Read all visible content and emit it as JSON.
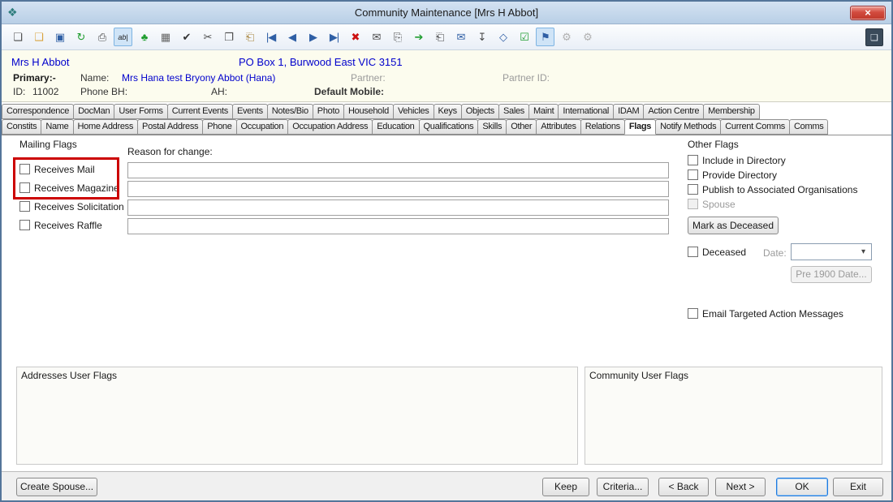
{
  "window": {
    "title": "Community Maintenance  [Mrs H Abbot]",
    "app_icon_glyph": "❖",
    "close_glyph": "×"
  },
  "toolbar": {
    "icons": [
      {
        "name": "new-document-icon",
        "glyph": "❏",
        "color": "#4a4a4a"
      },
      {
        "name": "open-folder-icon",
        "glyph": "❑",
        "color": "#d9a33c"
      },
      {
        "name": "save-icon",
        "glyph": "▣",
        "color": "#2f5fa5"
      },
      {
        "name": "refresh-icon",
        "glyph": "↻",
        "color": "#1f9d2f"
      },
      {
        "name": "print-icon",
        "glyph": "⎙",
        "color": "#4a4a4a"
      },
      {
        "name": "textbox-edit-icon",
        "glyph": "ab|",
        "color": "#1a1a1a",
        "pressed": true,
        "text": true
      },
      {
        "name": "tree-icon",
        "glyph": "♣",
        "color": "#1f9d2f"
      },
      {
        "name": "table-icon",
        "glyph": "▦",
        "color": "#666666"
      },
      {
        "name": "spellcheck-icon",
        "glyph": "✔",
        "color": "#333333"
      },
      {
        "name": "cut-icon",
        "glyph": "✂",
        "color": "#4a4a4a"
      },
      {
        "name": "copy-icon",
        "glyph": "❐",
        "color": "#4a4a4a"
      },
      {
        "name": "paste-icon",
        "glyph": "⎗",
        "color": "#a8843c"
      },
      {
        "name": "first-record-icon",
        "glyph": "|◀",
        "color": "#2f5fa5"
      },
      {
        "name": "previous-record-icon",
        "glyph": "◀",
        "color": "#2f5fa5"
      },
      {
        "name": "next-record-icon",
        "glyph": "▶",
        "color": "#2f5fa5"
      },
      {
        "name": "last-record-icon",
        "glyph": "▶|",
        "color": "#2f5fa5"
      },
      {
        "name": "delete-icon",
        "glyph": "✖",
        "color": "#cc1111"
      },
      {
        "name": "email-icon",
        "glyph": "✉",
        "color": "#4a4a4a"
      },
      {
        "name": "send-to-icon",
        "glyph": "⎘",
        "color": "#4a4a4a"
      },
      {
        "name": "forward-icon",
        "glyph": "➔",
        "color": "#1f9d2f"
      },
      {
        "name": "clipboard-import-icon",
        "glyph": "⎗",
        "color": "#4a4a4a"
      },
      {
        "name": "clipboard-mail-icon",
        "glyph": "✉",
        "color": "#2f5fa5"
      },
      {
        "name": "clipboard-export-icon",
        "glyph": "↧",
        "color": "#4a4a4a"
      },
      {
        "name": "tag-icon",
        "glyph": "◇",
        "color": "#2f5fa5"
      },
      {
        "name": "checklist-icon",
        "glyph": "☑",
        "color": "#1f9d2f"
      },
      {
        "name": "pushpin-icon",
        "glyph": "⚑",
        "color": "#2f5fa5",
        "pressed": true
      },
      {
        "name": "settings-gears-icon",
        "glyph": "⚙",
        "color": "#b0b0b0"
      },
      {
        "name": "sync-gears-icon",
        "glyph": "⚙",
        "color": "#b0b0b0"
      }
    ],
    "right_icon": {
      "name": "panel-toggle-icon",
      "glyph": "❏"
    }
  },
  "header": {
    "display_name": "Mrs H Abbot",
    "address": "PO Box 1, Burwood East VIC 3151",
    "primary_label": "Primary:-",
    "name_label": "Name:",
    "name_value": "Mrs Hana test Bryony Abbot (Hana)",
    "partner_label": "Partner:",
    "partner_id_label": "Partner ID:",
    "id_label": "ID:",
    "id_value": "11002",
    "phone_bh_label": "Phone BH:",
    "ah_label": "AH:",
    "default_mobile_label": "Default Mobile:"
  },
  "tabs": {
    "row1": [
      "Correspondence",
      "DocMan",
      "User Forms",
      "Current Events",
      "Events",
      "Notes/Bio",
      "Photo",
      "Household",
      "Vehicles",
      "Keys",
      "Objects",
      "Sales",
      "Maint",
      "International",
      "IDAM",
      "Action Centre",
      "Membership"
    ],
    "row2": [
      "Constits",
      "Name",
      "Home Address",
      "Postal Address",
      "Phone",
      "Occupation",
      "Occupation Address",
      "Education",
      "Qualifications",
      "Skills",
      "Other",
      "Attributes",
      "Relations",
      "Flags",
      "Notify Methods",
      "Current Comms",
      "Comms"
    ],
    "selected": "Flags"
  },
  "mailing_flags": {
    "group_label": "Mailing Flags",
    "reason_label": "Reason for change:",
    "checkboxes": [
      {
        "label": "Receives Mail",
        "checked": false,
        "highlighted": true
      },
      {
        "label": "Receives Magazine",
        "checked": false,
        "highlighted": true
      },
      {
        "label": "Receives Solicitation",
        "checked": false
      },
      {
        "label": "Receives Raffle",
        "checked": false
      }
    ],
    "reason_fields": [
      "",
      "",
      "",
      ""
    ]
  },
  "other_flags": {
    "group_label": "Other Flags",
    "checkboxes": [
      {
        "label": "Include in Directory",
        "checked": false
      },
      {
        "label": "Provide Directory",
        "checked": false
      },
      {
        "label": "Publish to Associated Organisations",
        "checked": false
      },
      {
        "label": "Spouse",
        "checked": false,
        "disabled": true
      }
    ],
    "mark_deceased_button": "Mark as Deceased",
    "deceased_checkbox": "Deceased",
    "date_label": "Date:",
    "date_value": "",
    "pre1900_button": "Pre 1900 Date...",
    "email_targeted_checkbox": "Email Targeted Action Messages"
  },
  "user_flags": {
    "addresses_label": "Addresses User Flags",
    "community_label": "Community User Flags"
  },
  "footer": {
    "create_spouse": "Create Spouse...",
    "buttons": [
      "Keep",
      "Criteria...",
      "< Back",
      "Next >",
      "OK",
      "Exit"
    ],
    "default_button": "OK"
  },
  "annotation": {
    "color": "#cc0000"
  }
}
